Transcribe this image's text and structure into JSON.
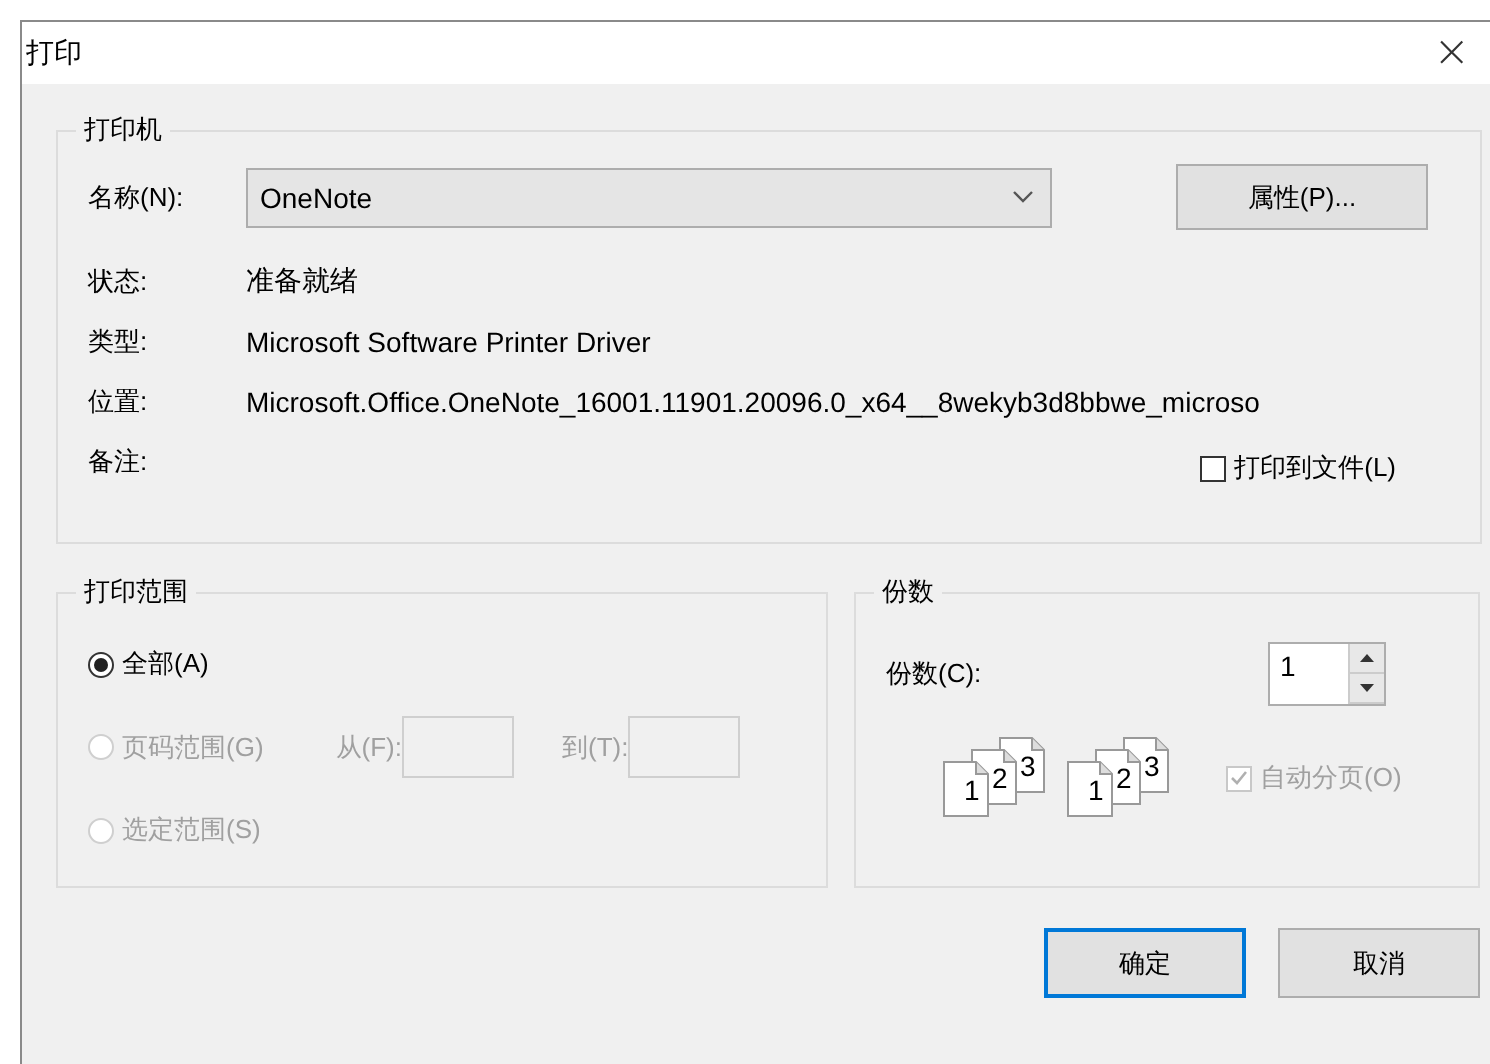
{
  "window": {
    "title": "打印",
    "close": "×"
  },
  "printer": {
    "title": "打印机",
    "name_label": "名称(N):",
    "name_value": "OneNote",
    "properties_button": "属性(P)...",
    "info": [
      {
        "label": "状态:",
        "value": "准备就绪"
      },
      {
        "label": "类型:",
        "value": "Microsoft Software Printer Driver"
      },
      {
        "label": "位置:",
        "value": "Microsoft.Office.OneNote_16001.11901.20096.0_x64__8wekyb3d8bbwe_microso"
      },
      {
        "label": "备注:"
      }
    ],
    "print_to_file": {
      "label": "打印到文件(L)",
      "checked": false
    }
  },
  "range": {
    "title": "打印范围",
    "options": [
      {
        "label": "全部(A)",
        "selected": true,
        "disabled": false
      },
      {
        "label": "页码范围(G)",
        "selected": false,
        "disabled": true
      },
      {
        "label": "选定范围(S)",
        "selected": false,
        "disabled": true
      }
    ],
    "from_label": "从(F):",
    "to_label": "到(T):",
    "fields_disabled": true
  },
  "copies": {
    "title": "份数",
    "count_label": "份数(C):",
    "count_value": "1",
    "stacks": [
      {
        "pages": [
          "1",
          "2",
          "3"
        ]
      },
      {
        "pages": [
          "1",
          "2",
          "3"
        ]
      }
    ],
    "collate": {
      "label": "自动分页(O)",
      "checked": true,
      "disabled": true
    }
  },
  "buttons": [
    {
      "label": "确定",
      "default": true
    },
    {
      "label": "取消",
      "default": false
    }
  ]
}
